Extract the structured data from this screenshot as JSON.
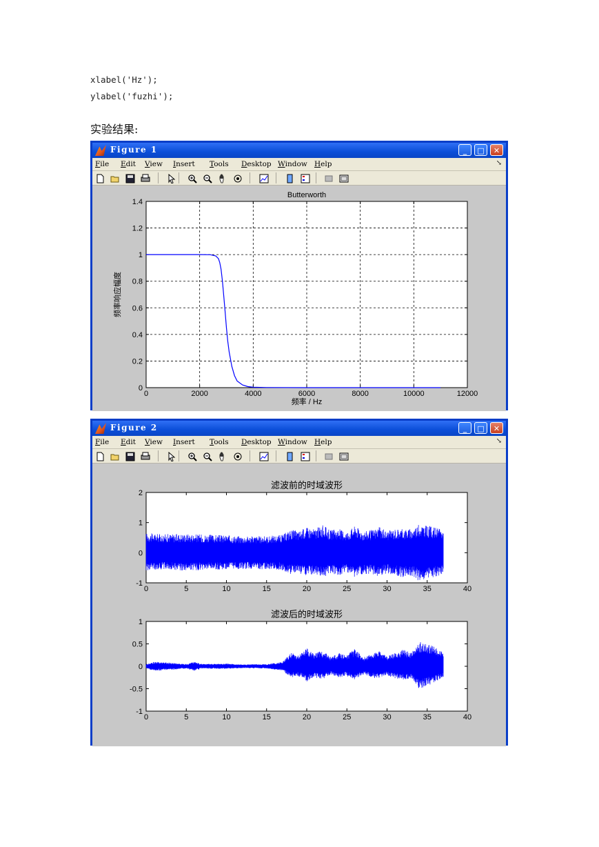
{
  "code_lines": [
    "xlabel('Hz');",
    "ylabel('fuzhi');"
  ],
  "section_heading": "实验结果:",
  "menus": [
    "File",
    "Edit",
    "View",
    "Insert",
    "Tools",
    "Desktop",
    "Window",
    "Help"
  ],
  "toolbar_icons": [
    "new-file-icon",
    "open-folder-icon",
    "save-icon",
    "print-icon",
    "arrow-cursor-icon",
    "zoom-in-icon",
    "zoom-out-icon",
    "pan-hand-icon",
    "rotate-3d-icon",
    "data-cursor-icon",
    "colorbar-icon",
    "legend-icon",
    "hide-plot-tools-icon",
    "show-plot-tools-icon"
  ],
  "window_buttons": {
    "minimize": "_",
    "maximize": "□",
    "close": "✕"
  },
  "figure1": {
    "window_title": "Figure 1",
    "chart_data": {
      "type": "line",
      "title": "Butterworth",
      "xlabel": "频率 / Hz",
      "ylabel": "频率响应幅度",
      "xlim": [
        0,
        12000
      ],
      "ylim": [
        0,
        1.4
      ],
      "xticks": [
        0,
        2000,
        4000,
        6000,
        8000,
        10000,
        12000
      ],
      "yticks": [
        0,
        0.2,
        0.4,
        0.6,
        0.8,
        1,
        1.2,
        1.4
      ],
      "ytick_labels": [
        "0",
        "0.2",
        "0.4",
        "0.6",
        "0.8",
        "1",
        "1.2",
        "1.4"
      ],
      "grid": true,
      "series": [
        {
          "color": "#0000ff",
          "x": [
            0,
            2000,
            2400,
            2600,
            2700,
            2750,
            2800,
            2850,
            2900,
            2950,
            3000,
            3050,
            3100,
            3200,
            3300,
            3400,
            3600,
            3800,
            4000,
            4500,
            6000,
            8000,
            11000
          ],
          "y": [
            1,
            1,
            0.999,
            0.99,
            0.97,
            0.94,
            0.89,
            0.8,
            0.69,
            0.57,
            0.45,
            0.35,
            0.27,
            0.16,
            0.09,
            0.05,
            0.02,
            0.008,
            0.003,
            0.001,
            0,
            0,
            0
          ]
        }
      ]
    }
  },
  "figure2": {
    "window_title": "Figure 2",
    "chart_data": [
      {
        "type": "line",
        "title": "滤波前的时域波形",
        "xlim": [
          0,
          40
        ],
        "ylim": [
          -1,
          2
        ],
        "xticks": [
          0,
          5,
          10,
          15,
          20,
          25,
          30,
          35,
          40
        ],
        "yticks": [
          -1,
          0,
          1,
          2
        ],
        "ytick_labels": [
          "-1",
          "0",
          "1",
          "2"
        ],
        "grid": false,
        "series": [
          {
            "color": "#0000ff",
            "x": [
              0,
              2,
              5,
              8,
              10,
              12,
              15,
              17,
              18,
              19,
              20,
              21,
              22,
              23,
              24,
              25,
              26,
              27,
              28,
              29,
              30,
              31,
              32,
              33,
              34,
              35,
              36,
              37
            ],
            "envelope_upper": [
              0.65,
              0.62,
              0.63,
              0.6,
              0.58,
              0.55,
              0.55,
              0.6,
              0.78,
              0.72,
              0.85,
              0.8,
              0.92,
              0.75,
              0.8,
              0.7,
              0.9,
              0.72,
              0.75,
              0.85,
              0.72,
              0.8,
              0.8,
              0.78,
              0.95,
              0.9,
              0.85,
              0.75
            ],
            "envelope_lower": [
              -0.6,
              -0.55,
              -0.6,
              -0.58,
              -0.55,
              -0.55,
              -0.55,
              -0.58,
              -0.72,
              -0.68,
              -0.8,
              -0.7,
              -0.82,
              -0.7,
              -0.75,
              -0.65,
              -0.85,
              -0.7,
              -0.72,
              -0.8,
              -0.68,
              -0.75,
              -0.85,
              -0.75,
              -0.95,
              -0.85,
              -0.8,
              -0.7
            ]
          }
        ]
      },
      {
        "type": "line",
        "title": "滤波后的时域波形",
        "xlim": [
          0,
          40
        ],
        "ylim": [
          -1,
          1
        ],
        "xticks": [
          0,
          5,
          10,
          15,
          20,
          25,
          30,
          35,
          40
        ],
        "yticks": [
          -1,
          -0.5,
          0,
          0.5,
          1
        ],
        "ytick_labels": [
          "-1",
          "-0.5",
          "0",
          "0.5",
          "1"
        ],
        "grid": false,
        "series": [
          {
            "color": "#0000ff",
            "x": [
              0,
              1,
              3,
              5,
              6,
              7,
              10,
              12,
              15,
              17,
              18,
              19,
              20,
              21,
              22,
              23,
              24,
              25,
              26,
              27,
              28,
              29,
              30,
              31,
              32,
              33,
              34,
              35,
              36,
              37
            ],
            "envelope_upper": [
              0.05,
              0.1,
              0.08,
              0.05,
              0.1,
              0.05,
              0.06,
              0.04,
              0.05,
              0.1,
              0.3,
              0.25,
              0.4,
              0.3,
              0.35,
              0.2,
              0.3,
              0.25,
              0.4,
              0.2,
              0.28,
              0.35,
              0.22,
              0.3,
              0.38,
              0.3,
              0.55,
              0.5,
              0.45,
              0.3
            ],
            "envelope_lower": [
              -0.05,
              -0.1,
              -0.08,
              -0.05,
              -0.1,
              -0.05,
              -0.06,
              -0.04,
              -0.05,
              -0.1,
              -0.25,
              -0.22,
              -0.35,
              -0.25,
              -0.3,
              -0.18,
              -0.25,
              -0.22,
              -0.3,
              -0.18,
              -0.25,
              -0.28,
              -0.2,
              -0.28,
              -0.3,
              -0.28,
              -0.5,
              -0.45,
              -0.35,
              -0.25
            ]
          }
        ]
      }
    ]
  }
}
